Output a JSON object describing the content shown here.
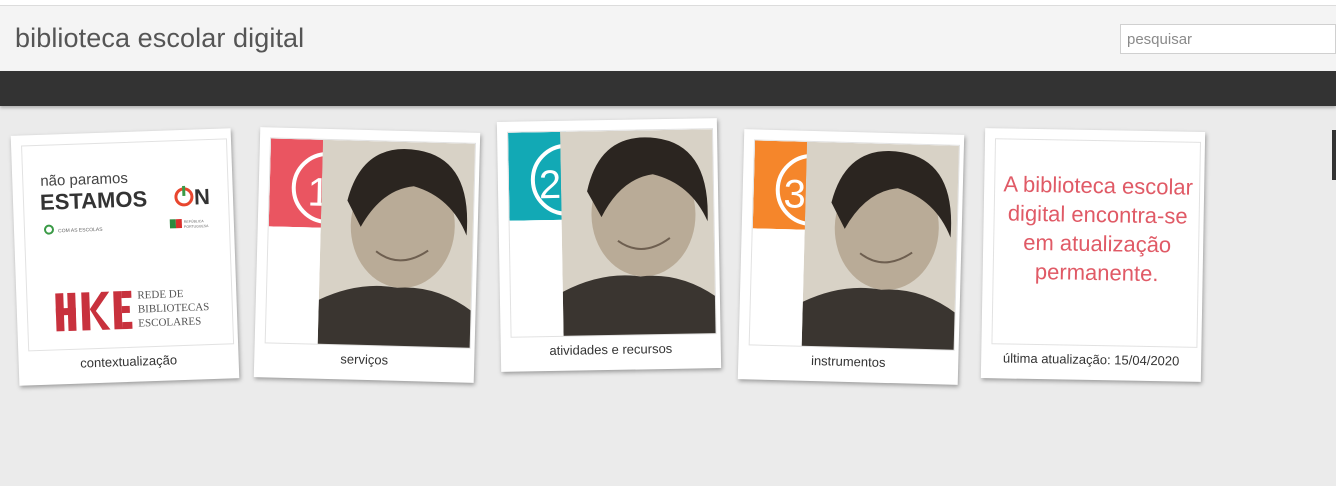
{
  "header": {
    "site_title": "biblioteca escolar digital",
    "search_placeholder": "pesquisar"
  },
  "cards": [
    {
      "caption": "contextualização",
      "logo_lines": [
        "não paramos",
        "ESTAMOS ON",
        "COM AS ESCOLAS",
        "REPÚBLICA PORTUGUESA"
      ],
      "rbe_lines": [
        "REDE DE",
        "BIBLIOTECAS",
        "ESCOLARES"
      ]
    },
    {
      "caption": "serviços",
      "number": "1",
      "color": "#ea5561"
    },
    {
      "caption": "atividades e recursos",
      "number": "2",
      "color": "#12a9b5"
    },
    {
      "caption": "instrumentos",
      "number": "3",
      "color": "#f5862b"
    },
    {
      "caption": "última atualização: 15/04/2020",
      "message": "A biblioteca escolar digital encontra-se em atualização permanente."
    }
  ]
}
